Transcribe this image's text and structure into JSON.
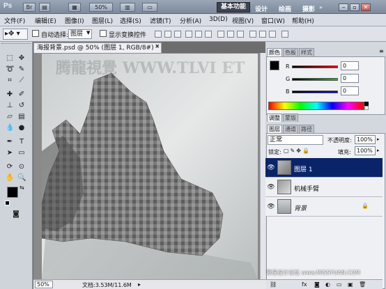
{
  "titlebar": {
    "logo": "Ps",
    "zoom": "50%",
    "workspaces": [
      "基本功能",
      "设计",
      "绘画",
      "摄影"
    ],
    "accent": "#0a246a"
  },
  "menu": [
    "文件(F)",
    "编辑(E)",
    "图像(I)",
    "图层(L)",
    "选择(S)",
    "滤镜(T)",
    "分析(A)",
    "3D(D)",
    "视图(V)",
    "窗口(W)",
    "帮助(H)"
  ],
  "options": {
    "auto_select_label": "自动选择:",
    "auto_select_value": "图层",
    "show_transform_label": "显示变换控件"
  },
  "document": {
    "tab_title": "海报背景.psd @ 50% (图层 1, RGB/8#) *",
    "watermark": "腾龍視覺 WWW.TLVI  ET",
    "zoom": "50%",
    "doc_size": "文档:3.53M/11.6M"
  },
  "color_panel": {
    "tabs": [
      "颜色",
      "色板",
      "样式"
    ],
    "channels": [
      {
        "label": "R",
        "value": "0"
      },
      {
        "label": "G",
        "value": "0"
      },
      {
        "label": "B",
        "value": "0"
      }
    ]
  },
  "adjust_tabs": [
    "调整",
    "蒙版"
  ],
  "layers_panel": {
    "tabs": [
      "图层",
      "通道",
      "路径"
    ],
    "blend_mode": "正常",
    "opacity_label": "不透明度:",
    "opacity_value": "100%",
    "lock_label": "锁定:",
    "fill_label": "填充:",
    "fill_value": "100%",
    "layers": [
      {
        "name": "图层 1",
        "selected": true
      },
      {
        "name": "机械手臂",
        "selected": false
      },
      {
        "name": "背景",
        "selected": false,
        "locked": true
      }
    ]
  },
  "site_watermark": "思缘设计论坛 www.MISSYUAN.COM"
}
